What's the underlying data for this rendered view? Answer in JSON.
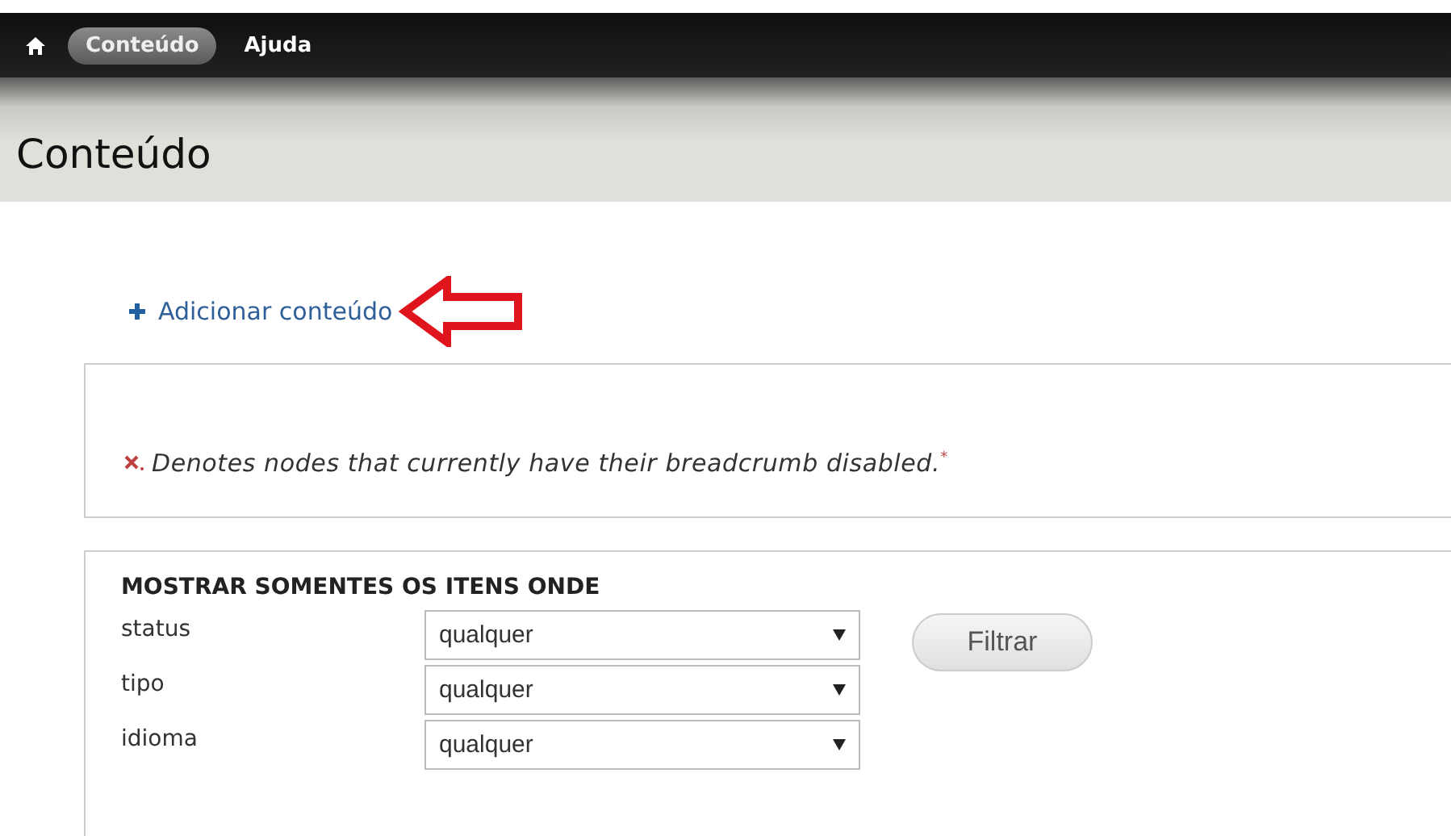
{
  "toolbar": {
    "tabs": [
      {
        "label": "Conteúdo",
        "selected": true
      },
      {
        "label": "Ajuda",
        "selected": false
      }
    ]
  },
  "page_title": "Conteúdo",
  "action_link": "Adicionar conteúdo",
  "note": "Denotes nodes that currently have their breadcrumb disabled.$^{*}$",
  "filter": {
    "legend": "MOSTRAR SOMENTES OS ITENS ONDE",
    "rows": [
      {
        "label": "status",
        "value": "qualquer"
      },
      {
        "label": "tipo",
        "value": "qualquer"
      },
      {
        "label": "idioma",
        "value": "qualquer"
      }
    ],
    "button": "Filtrar"
  }
}
